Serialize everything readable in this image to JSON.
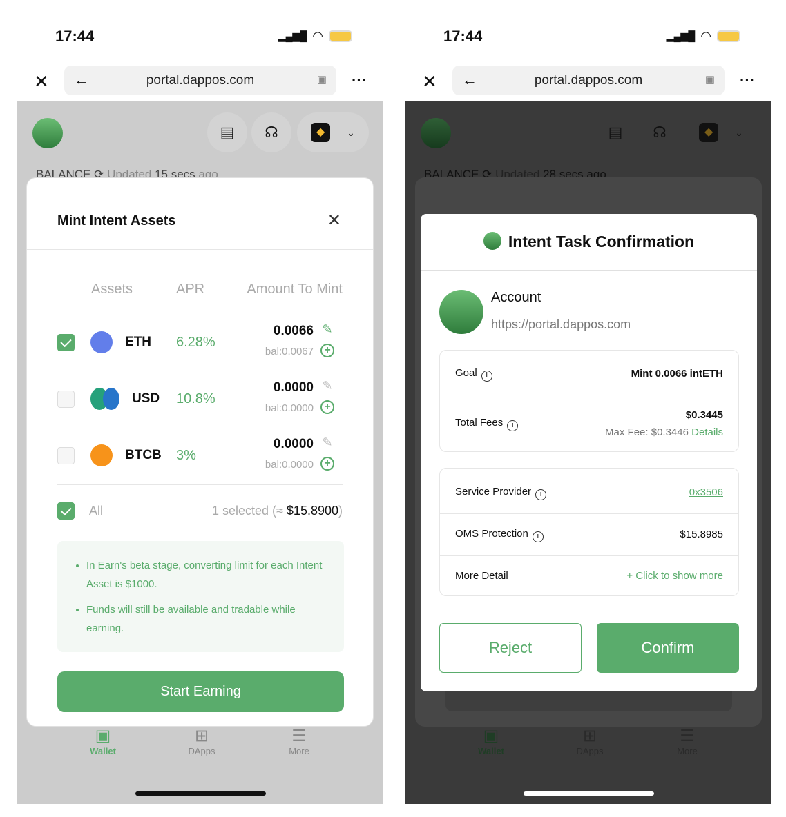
{
  "left": {
    "status": {
      "time": "17:44"
    },
    "browser": {
      "url": "portal.dappos.com"
    },
    "balance": {
      "label": "BALANCE",
      "updated_prefix": "Updated",
      "updated_value": "15 secs",
      "updated_suffix": "ago"
    },
    "modal": {
      "title": "Mint Intent Assets",
      "headers": {
        "assets": "Assets",
        "apr": "APR",
        "amount": "Amount To Mint"
      },
      "assets": [
        {
          "symbol": "ETH",
          "apr": "6.28%",
          "amount": "0.0066",
          "balance": "bal:0.0067",
          "checked": true
        },
        {
          "symbol": "USD",
          "apr": "10.8%",
          "amount": "0.0000",
          "balance": "bal:0.0000",
          "checked": false
        },
        {
          "symbol": "BTCB",
          "apr": "3%",
          "amount": "0.0000",
          "balance": "bal:0.0000",
          "checked": false
        }
      ],
      "all_label": "All",
      "selected_prefix": "1 selected (≈",
      "selected_value": "$15.8900",
      "selected_suffix": ")",
      "notes": [
        "In Earn's beta stage, converting limit for each Intent Asset is $1000.",
        "Funds will still be available and tradable while earning."
      ],
      "start_button": "Start Earning"
    },
    "nav": {
      "wallet": "Wallet",
      "dapps": "DApps",
      "more": "More"
    }
  },
  "right": {
    "status": {
      "time": "17:44"
    },
    "browser": {
      "url": "portal.dappos.com"
    },
    "balance": {
      "label": "BALANCE",
      "updated_prefix": "Updated",
      "updated_value": "28 secs",
      "updated_suffix": "ago"
    },
    "dialog": {
      "title": "Intent Task Confirmation",
      "account_label": "Account",
      "account_url": "https://portal.dappos.com",
      "goal_label": "Goal",
      "goal_value": "Mint 0.0066 intETH",
      "fees_label": "Total Fees",
      "fees_value": "$0.3445",
      "max_fee": "Max Fee: $0.3446",
      "details_link": "Details",
      "provider_label": "Service Provider",
      "provider_value": "0x3506",
      "oms_label": "OMS Protection",
      "oms_value": "$15.8985",
      "more_label": "More Detail",
      "more_link": "+ Click to show more",
      "reject": "Reject",
      "confirm": "Confirm"
    },
    "nav": {
      "wallet": "Wallet",
      "dapps": "DApps",
      "more": "More"
    }
  },
  "colors": {
    "accent": "#5aac6c",
    "overlay_light": "#cccccc",
    "overlay_dark": "#3a3a3a"
  }
}
